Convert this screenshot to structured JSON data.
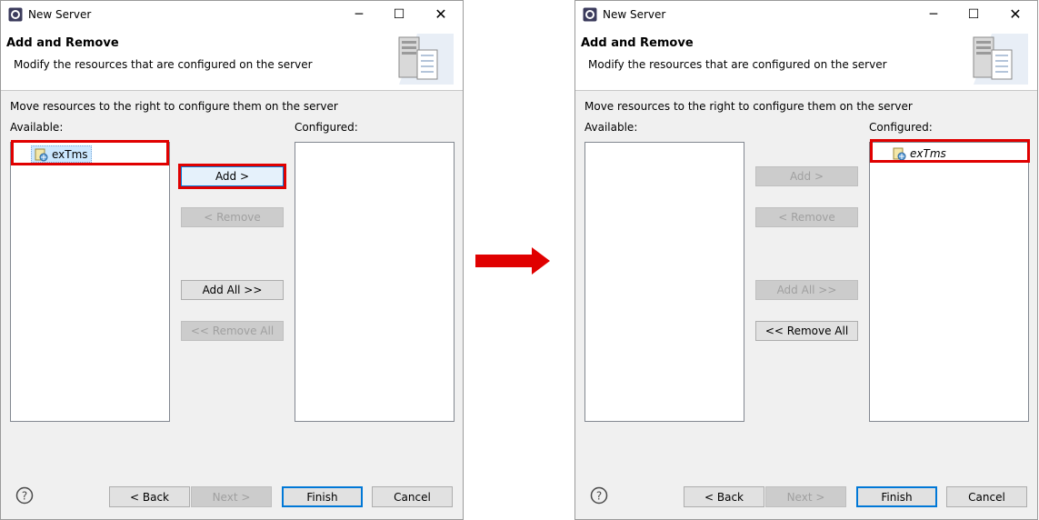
{
  "windows": [
    {
      "title": "New Server",
      "header": {
        "title": "Add and Remove",
        "description": "Modify the resources that are configured on the server"
      },
      "instruction": "Move resources to the right to configure them on the server",
      "available_label": "Available:",
      "configured_label": "Configured:",
      "available_items": [
        "exTms"
      ],
      "configured_items": [],
      "buttons": {
        "add": "Add >",
        "remove": "< Remove",
        "add_all": "Add All >>",
        "remove_all": "<< Remove All"
      },
      "footer": {
        "back": "< Back",
        "next": "Next >",
        "finish": "Finish",
        "cancel": "Cancel"
      }
    },
    {
      "title": "New Server",
      "header": {
        "title": "Add and Remove",
        "description": "Modify the resources that are configured on the server"
      },
      "instruction": "Move resources to the right to configure them on the server",
      "available_label": "Available:",
      "configured_label": "Configured:",
      "available_items": [],
      "configured_items": [
        "exTms"
      ],
      "buttons": {
        "add": "Add >",
        "remove": "< Remove",
        "add_all": "Add All >>",
        "remove_all": "<< Remove All"
      },
      "footer": {
        "back": "< Back",
        "next": "Next >",
        "finish": "Finish",
        "cancel": "Cancel"
      }
    }
  ],
  "annotation": {
    "highlight_color": "#e00000",
    "arrow_color": "#e00000"
  },
  "colors": {
    "selection": "#cce8ff",
    "focus_border": "#0078d7"
  }
}
